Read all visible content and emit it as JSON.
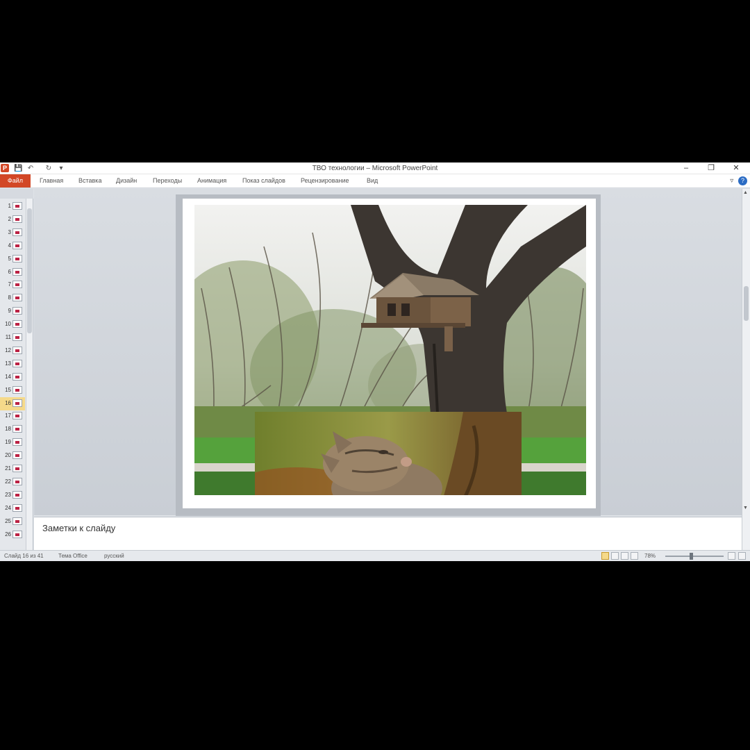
{
  "window": {
    "title": "ТВО технологии – Microsoft PowerPoint",
    "minimize": "–",
    "restore": "❐",
    "close": "✕",
    "app_icon": "P"
  },
  "quick_access": {
    "save": "💾",
    "undo": "↶",
    "redo": "↻",
    "customize": "▾"
  },
  "ribbon": {
    "file_label": "Файл",
    "tabs": [
      "Главная",
      "Вставка",
      "Дизайн",
      "Переходы",
      "Анимация",
      "Показ слайдов",
      "Рецензирование",
      "Вид"
    ],
    "collapse": "▿",
    "help": "?"
  },
  "thumbnails": {
    "numbers": [
      "1",
      "2",
      "3",
      "4",
      "5",
      "6",
      "7",
      "8",
      "9",
      "10",
      "11",
      "12",
      "13",
      "14",
      "15",
      "16",
      "17",
      "18",
      "19",
      "20",
      "21",
      "22",
      "23",
      "24",
      "25",
      "26"
    ],
    "active_index": 15
  },
  "notes": {
    "placeholder": "Заметки к слайду"
  },
  "status": {
    "slide_info": "Слайд 16 из 41",
    "theme": "Тема Office",
    "language": "русский",
    "zoom": "78%"
  }
}
